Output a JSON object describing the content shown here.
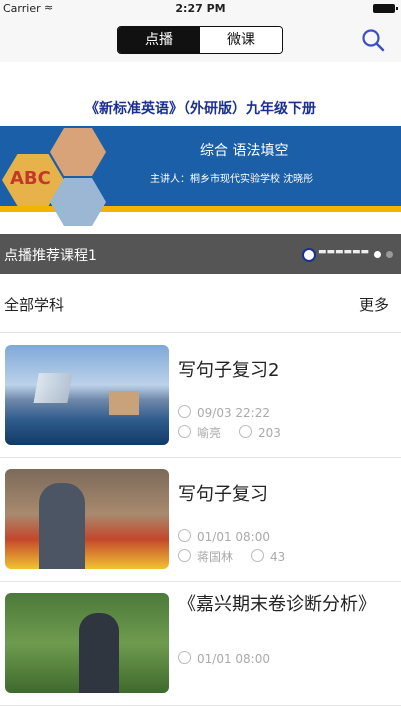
{
  "status_bar": {
    "carrier": "Carrier",
    "time": "2:27 PM"
  },
  "nav": {
    "tabs": [
      {
        "label": "点播",
        "selected": true
      },
      {
        "label": "微课",
        "selected": false
      }
    ]
  },
  "banner": {
    "book_title": "《新标准英语》（外研版）九年级下册",
    "subtitle": "综合 语法填空",
    "lecturer": "主讲人：桐乡市现代实验学校 沈晓彤",
    "letters": "ABC"
  },
  "recommend": {
    "label": "点播推荐课程1",
    "page_count": 2,
    "current_page": 1
  },
  "section": {
    "title": "全部学科",
    "more": "更多"
  },
  "courses": [
    {
      "title": "写句子复习2",
      "time": "09/03 22:22",
      "author": "喻亮",
      "views": "203"
    },
    {
      "title": "写句子复习",
      "time": "01/01 08:00",
      "author": "蒋国林",
      "views": "43"
    },
    {
      "title": "《嘉兴期末卷诊断分析》",
      "time": "01/01 08:00"
    }
  ],
  "colors": {
    "band": "#1b5fa8",
    "gold": "#f4b300",
    "navy": "#1a2f8f"
  }
}
